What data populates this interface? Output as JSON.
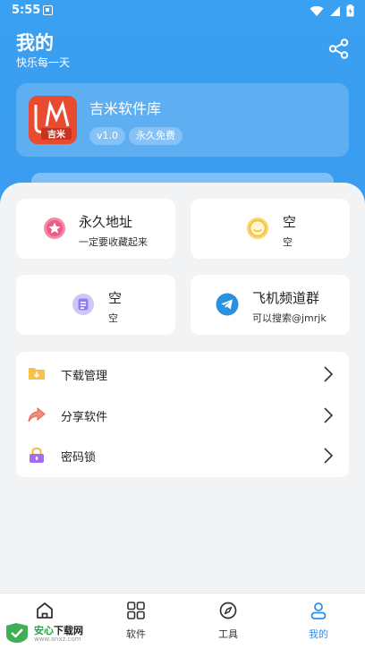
{
  "status_bar": {
    "time": "5:55"
  },
  "header": {
    "title": "我的",
    "subtitle": "快乐每一天"
  },
  "app": {
    "name": "吉米软件库",
    "logo_text": "吉米",
    "version": "v1.0",
    "license": "永久免费"
  },
  "cards": [
    {
      "title": "永久地址",
      "subtitle": "一定要收藏起来",
      "icon": "star-icon"
    },
    {
      "title": "空",
      "subtitle": "空",
      "icon": "smile-icon"
    },
    {
      "title": "空",
      "subtitle": "空",
      "icon": "document-icon"
    },
    {
      "title": "飞机频道群",
      "subtitle": "可以搜索@jmrjk",
      "icon": "telegram-icon"
    }
  ],
  "menu": [
    {
      "label": "下载管理",
      "icon": "folder-download-icon"
    },
    {
      "label": "分享软件",
      "icon": "share-arrow-icon"
    },
    {
      "label": "密码锁",
      "icon": "lock-icon"
    }
  ],
  "tabs": [
    {
      "label": "首页",
      "icon": "home-icon"
    },
    {
      "label": "软件",
      "icon": "grid-icon"
    },
    {
      "label": "工具",
      "icon": "compass-icon"
    },
    {
      "label": "我的",
      "icon": "user-icon",
      "active": true
    }
  ],
  "watermark": {
    "name_green": "安心",
    "name_dark": "下载网",
    "url": "www.anxz.com"
  },
  "colors": {
    "primary": "#3a9ef1",
    "active_tab": "#2f8fe8"
  }
}
